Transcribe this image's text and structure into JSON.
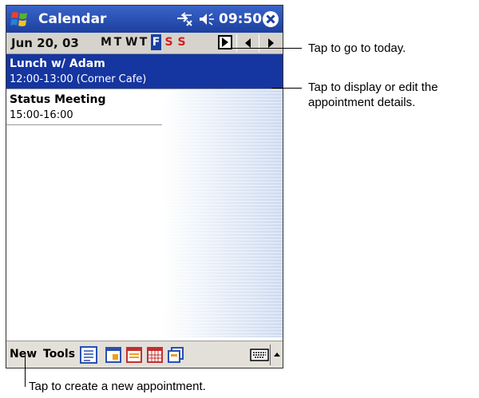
{
  "titlebar": {
    "app_title": "Calendar",
    "time": "09:50"
  },
  "datebar": {
    "date": "Jun 20, 03",
    "weekdays": [
      {
        "label": "M",
        "state": "normal"
      },
      {
        "label": "T",
        "state": "normal"
      },
      {
        "label": "W",
        "state": "normal"
      },
      {
        "label": "T",
        "state": "normal"
      },
      {
        "label": "F",
        "state": "selected"
      },
      {
        "label": "S",
        "state": "weekend"
      },
      {
        "label": "S",
        "state": "weekend"
      }
    ]
  },
  "appointments": [
    {
      "title": "Lunch w/ Adam",
      "time": "12:00-13:00 (Corner Cafe)",
      "selected": true
    },
    {
      "title": "Status Meeting",
      "time": "15:00-16:00",
      "selected": false
    }
  ],
  "bottom": {
    "new_label": "New",
    "tools_label": "Tools"
  },
  "callouts": {
    "today": "Tap to go to today.",
    "details_line1": "Tap to display or edit the",
    "details_line2": "appointment details.",
    "new_appt": "Tap to create a new appointment."
  },
  "colors": {
    "title_bar": "#1c3f9f",
    "selection": "#1535a0",
    "weekend": "#d02020"
  }
}
